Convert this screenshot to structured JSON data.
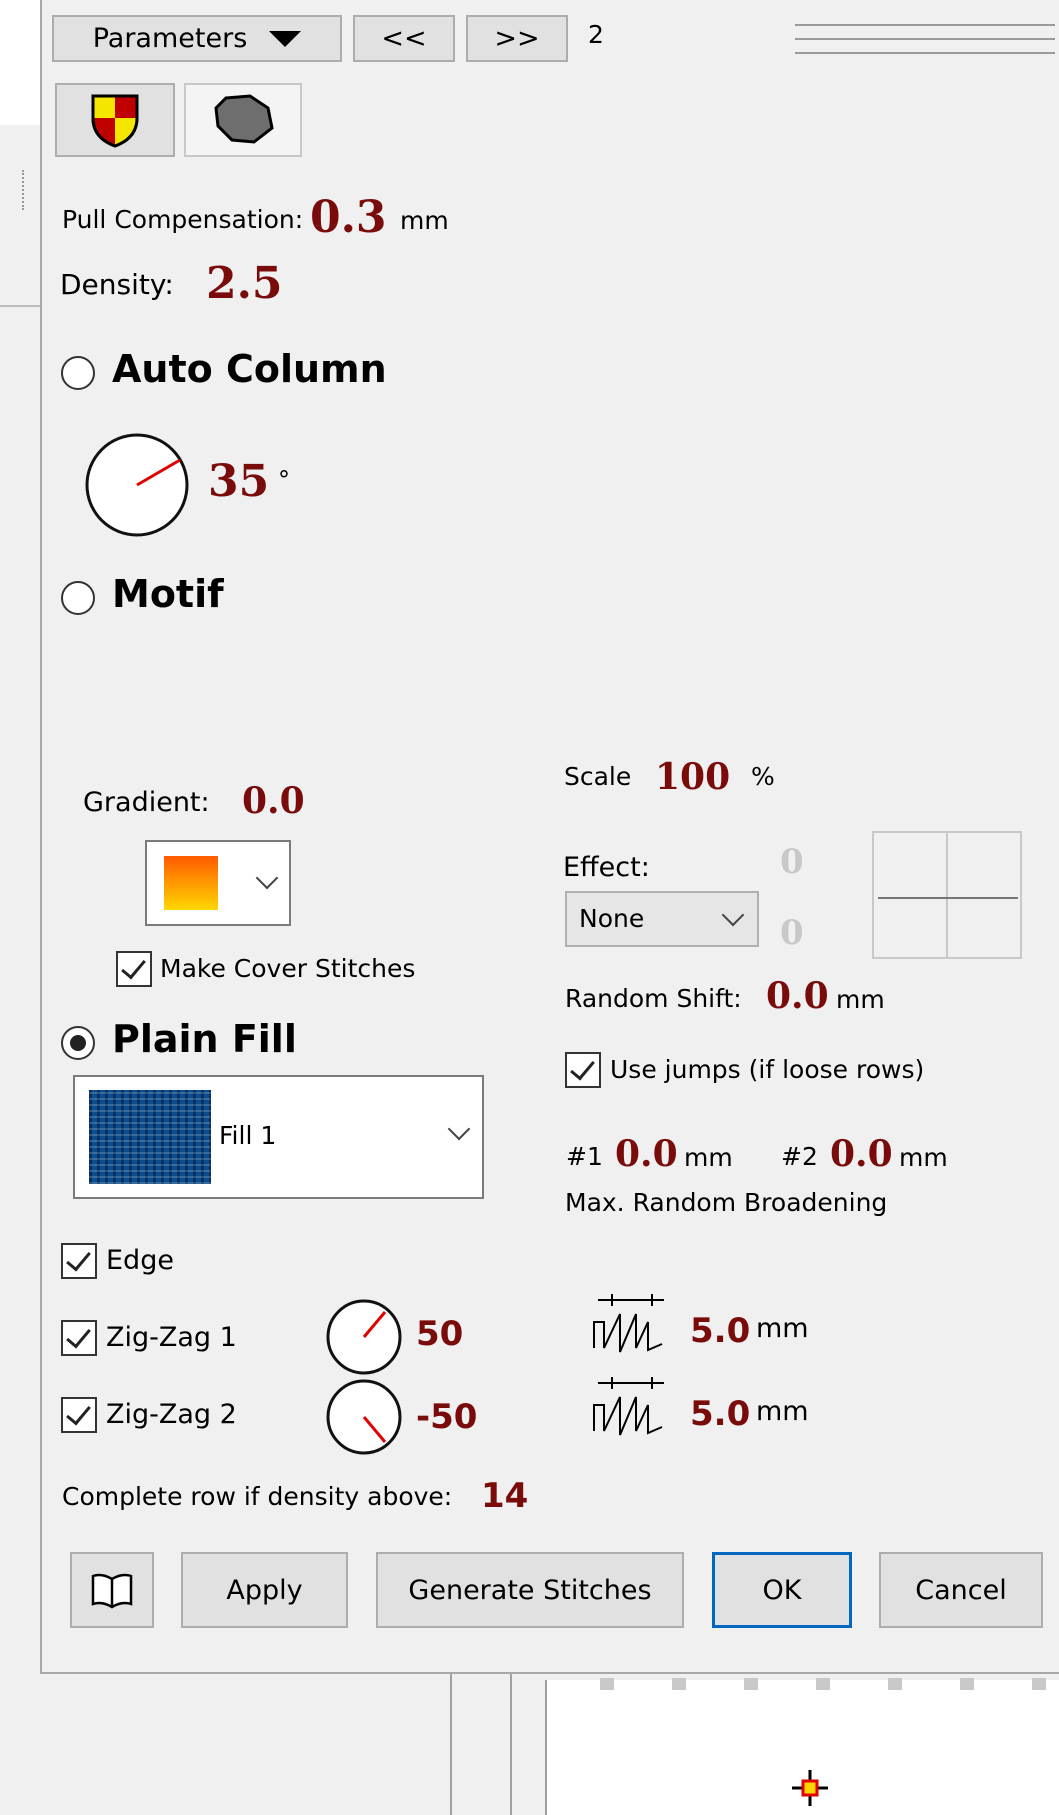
{
  "toolbar": {
    "parameters_label": "Parameters",
    "prev_label": "<<",
    "next_label": ">>",
    "page_number": "2"
  },
  "pull_compensation": {
    "label": "Pull Compensation:",
    "value": "0.3",
    "unit": "mm"
  },
  "density": {
    "label": "Density:",
    "value": "2.5"
  },
  "auto_column": {
    "label": "Auto Column",
    "angle": "35",
    "unit": "°",
    "selected": false
  },
  "motif": {
    "label": "Motif",
    "selected": false
  },
  "gradient": {
    "label": "Gradient:",
    "value": "0.0"
  },
  "scale": {
    "label": "Scale",
    "value": "100",
    "unit": "%"
  },
  "effect": {
    "label": "Effect:",
    "selected": "None",
    "value1": "0",
    "value2": "0"
  },
  "make_cover_stitches": {
    "label": "Make Cover Stitches",
    "checked": true
  },
  "random_shift": {
    "label": "Random Shift:",
    "value": "0.0",
    "unit": "mm"
  },
  "plain_fill": {
    "label": "Plain Fill",
    "selected": true,
    "fill_name": "Fill 1"
  },
  "use_jumps": {
    "label": "Use jumps (if loose rows)",
    "checked": true
  },
  "broadening": {
    "label1": "#1",
    "value1": "0.0",
    "unit1": "mm",
    "label2": "#2",
    "value2": "0.0",
    "unit2": "mm",
    "caption": "Max. Random Broadening"
  },
  "edge": {
    "label": "Edge",
    "checked": true
  },
  "zigzag1": {
    "label": "Zig-Zag 1",
    "checked": true,
    "angle": "50",
    "width": "5.0",
    "unit": "mm"
  },
  "zigzag2": {
    "label": "Zig-Zag 2",
    "checked": true,
    "angle": "-50",
    "width": "5.0",
    "unit": "mm"
  },
  "complete_row": {
    "label": "Complete row if density above:",
    "value": "14"
  },
  "buttons": {
    "apply": "Apply",
    "generate": "Generate Stitches",
    "ok": "OK",
    "cancel": "Cancel"
  },
  "colors": {
    "value": "#7a0b0b",
    "fill_pattern": "#2a7fb0",
    "ok_border": "#0067c0"
  }
}
